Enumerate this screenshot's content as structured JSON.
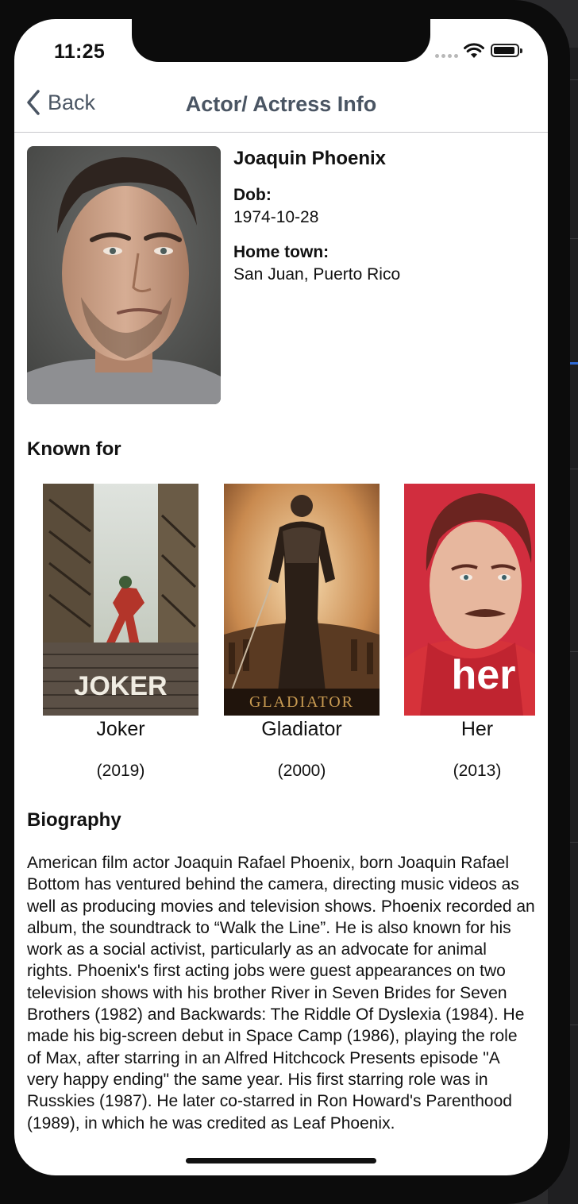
{
  "status_bar": {
    "time": "11:25"
  },
  "nav": {
    "back_label": "Back",
    "title": "Actor/ Actress Info"
  },
  "profile": {
    "name": "Joaquin Phoenix",
    "dob_label": "Dob:",
    "dob": "1974-10-28",
    "hometown_label": "Home town:",
    "hometown": "San Juan, Puerto Rico"
  },
  "known_for": {
    "heading": "Known for",
    "movies": [
      {
        "title": "Joker",
        "year": "(2019)",
        "poster_text": "JOKER"
      },
      {
        "title": "Gladiator",
        "year": "(2000)",
        "poster_text": "GLADIATOR"
      },
      {
        "title": "Her",
        "year": "(2013)",
        "poster_text": "her"
      }
    ]
  },
  "biography": {
    "heading": "Biography",
    "text": "American film actor Joaquin Rafael Phoenix, born Joaquin Rafael Bottom has ventured behind the camera, directing music videos as well as producing movies and television shows. Phoenix recorded an album, the soundtrack to “Walk the Line”. He is also known for his work as a social activist, particularly as an advocate for animal rights. Phoenix's first acting jobs were guest appearances on two television shows with his brother River in Seven Brides for Seven Brothers (1982) and Backwards: The Riddle Of Dyslexia (1984). He made his big-screen debut in Space Camp (1986), playing the role of Max, after starring in an Alfred Hitchcock Presents episode \"A very happy ending\" the same year. His first starring role was in Russkies (1987). He later co-starred in Ron Howard's Parenthood (1989), in which he was credited as Leaf Phoenix."
  }
}
